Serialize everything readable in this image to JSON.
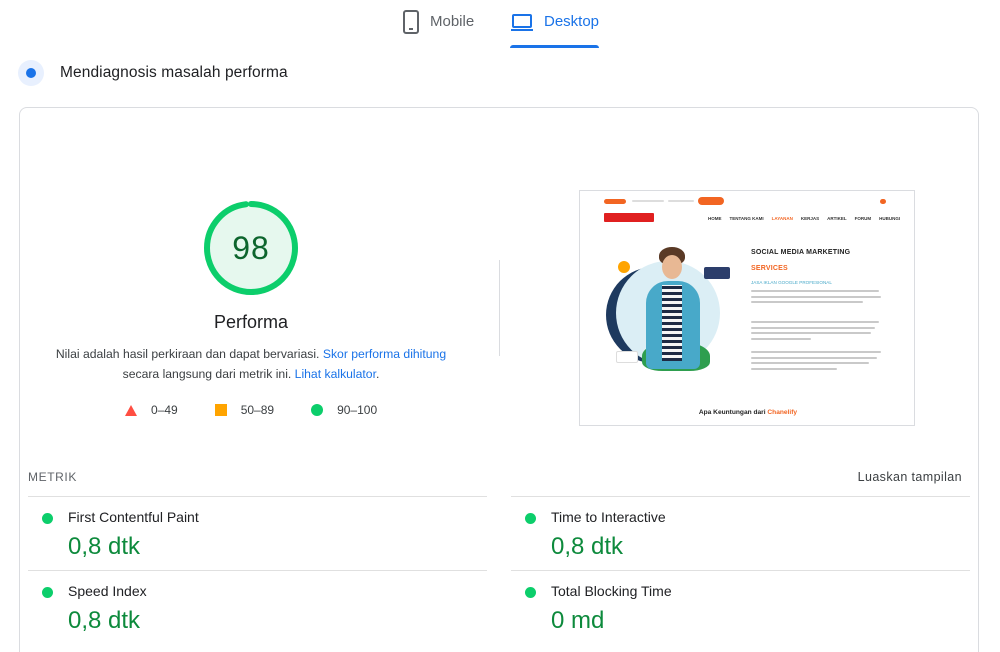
{
  "tabs": {
    "mobile": "Mobile",
    "desktop": "Desktop",
    "active": "desktop"
  },
  "diagnose": {
    "title": "Mendiagnosis masalah performa"
  },
  "score": {
    "value": 98,
    "value_text": "98",
    "label": "Performa",
    "desc_part1": "Nilai adalah hasil perkiraan dan dapat bervariasi. ",
    "desc_link1": "Skor performa dihitung",
    "desc_part2": "secara langsung dari metrik ini. ",
    "desc_link2": "Lihat kalkulator",
    "desc_part3": "."
  },
  "legend": [
    {
      "range": "0–49",
      "shape": "triangle",
      "color": "#ff4e42"
    },
    {
      "range": "50–89",
      "shape": "square",
      "color": "#ffa400"
    },
    {
      "range": "90–100",
      "shape": "circle",
      "color": "#0cce6b"
    }
  ],
  "thumbnail": {
    "nav": [
      "HOME",
      "TENTANG KAMI",
      "LAYANAN",
      "KERJAS",
      "ARTIKEL",
      "FORUM",
      "HUBUNGI"
    ],
    "nav_active": "LAYANAN",
    "heading1": "SOCIAL MEDIA MARKETING",
    "heading2": "SERVICES",
    "heading3": "JASA IKLAN GOOGLE PROFESIONAL",
    "footer_text": "Apa Keuntungan dari ",
    "footer_brand": "Chanelify"
  },
  "metrics": {
    "section_label": "METRIK",
    "expand_label": "Luaskan tampilan",
    "items": [
      {
        "name": "First Contentful Paint",
        "value": "0,8 dtk"
      },
      {
        "name": "Time to Interactive",
        "value": "0,8 dtk"
      },
      {
        "name": "Speed Index",
        "value": "0,8 dtk"
      },
      {
        "name": "Total Blocking Time",
        "value": "0 md"
      }
    ]
  },
  "colors": {
    "accent": "#1a73e8",
    "pass": "#0cce6b",
    "pass_text": "#0d8a3c"
  }
}
